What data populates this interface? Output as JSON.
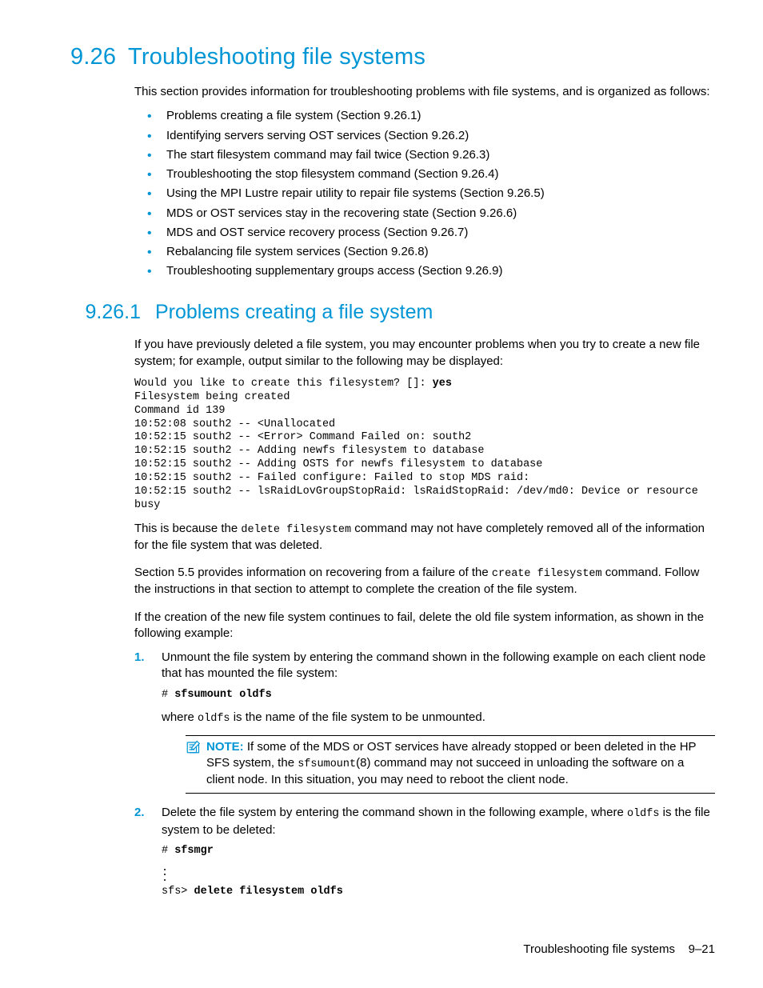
{
  "section": {
    "number": "9.26",
    "title": "Troubleshooting file systems",
    "intro": "This section provides information for troubleshooting problems with file systems, and is organized as follows:",
    "toc": [
      "Problems creating a file system (Section 9.26.1)",
      "Identifying servers serving OST services (Section 9.26.2)",
      "The start filesystem command may fail twice (Section 9.26.3)",
      "Troubleshooting the stop filesystem command (Section 9.26.4)",
      "Using the MPI Lustre repair utility to repair file systems (Section 9.26.5)",
      "MDS or OST services stay in the recovering state (Section 9.26.6)",
      "MDS and OST service recovery process (Section 9.26.7)",
      "Rebalancing file system services (Section 9.26.8)",
      "Troubleshooting supplementary groups access (Section 9.26.9)"
    ]
  },
  "subsection": {
    "number": "9.26.1",
    "title": "Problems creating a file system",
    "para1": "If you have previously deleted a file system, you may encounter problems when you try to create a new file system; for example, output similar to the following may be displayed:",
    "code1_prefix": "Would you like to create this filesystem? []: ",
    "code1_answer": "yes",
    "code1_body": "Filesystem being created\nCommand id 139\n10:52:08 south2 -- <Unallocated\n10:52:15 south2 -- <Error> Command Failed on: south2\n10:52:15 south2 -- Adding newfs filesystem to database\n10:52:15 south2 -- Adding OSTS for newfs filesystem to database\n10:52:15 south2 -- Failed configure: Failed to stop MDS raid:\n10:52:15 south2 -- lsRaidLovGroupStopRaid: lsRaidStopRaid: /dev/md0: Device or resource busy",
    "para2a": "This is because the ",
    "para2_cmd": "delete filesystem",
    "para2b": " command may not have completely removed all of the information for the file system that was deleted.",
    "para3a": "Section 5.5 provides information on recovering from a failure of the ",
    "para3_cmd": "create filesystem",
    "para3b": " command. Follow the instructions in that section to attempt to complete the creation of the file system.",
    "para4": "If the creation of the new file system continues to fail, delete the old file system information, as shown in the following example:",
    "step1_text": "Unmount the file system by entering the command shown in the following example on each client node that has mounted the file system:",
    "step1_code_prefix": "# ",
    "step1_code": "sfsumount oldfs",
    "step1_where_a": "where ",
    "step1_where_cmd": "oldfs",
    "step1_where_b": " is the name of the file system to be unmounted.",
    "note_label": "NOTE:",
    "note_a": "  If some of the MDS or OST services have already stopped or been deleted in the HP SFS system, the ",
    "note_cmd": "sfsumount",
    "note_b": "(8) command may not succeed in unloading the software on a client node. In this situation, you may need to reboot the client node.",
    "step2_a": "Delete the file system by entering the command shown in the following example, where ",
    "step2_cmd": "oldfs",
    "step2_b": " is the file system to be deleted:",
    "step2_code1_prefix": "# ",
    "step2_code1": "sfsmgr",
    "step2_code2_prefix": "sfs> ",
    "step2_code2": "delete filesystem oldfs"
  },
  "footer": {
    "text": "Troubleshooting file systems",
    "page": "9–21"
  }
}
